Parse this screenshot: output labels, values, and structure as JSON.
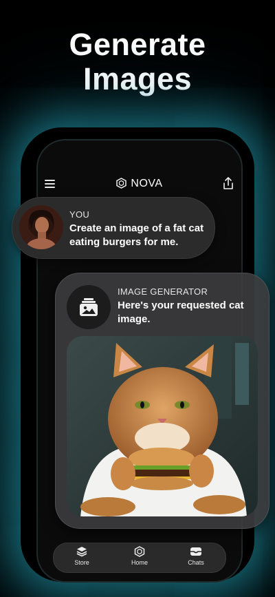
{
  "headline": {
    "line1": "Generate",
    "line2": "Images"
  },
  "app": {
    "brand": "NOVA",
    "icons": {
      "menu": "hamburger-menu-icon",
      "logo": "hexagon-logo-icon",
      "share": "share-icon"
    }
  },
  "user_message": {
    "sender": "YOU",
    "text": "Create an image of a fat cat eating burgers for me."
  },
  "bot_message": {
    "sender": "IMAGE GENERATOR",
    "text": "Here's your requested cat image.",
    "image_alt": "cat-eating-burger-image"
  },
  "tabs": [
    {
      "label": "Store",
      "icon": "layers-icon"
    },
    {
      "label": "Home",
      "icon": "hexagon-logo-icon"
    },
    {
      "label": "Chats",
      "icon": "chat-inbox-icon"
    }
  ],
  "colors": {
    "background": "#000000",
    "glow": "#28aabe",
    "bubble": "#2b2b2b"
  }
}
